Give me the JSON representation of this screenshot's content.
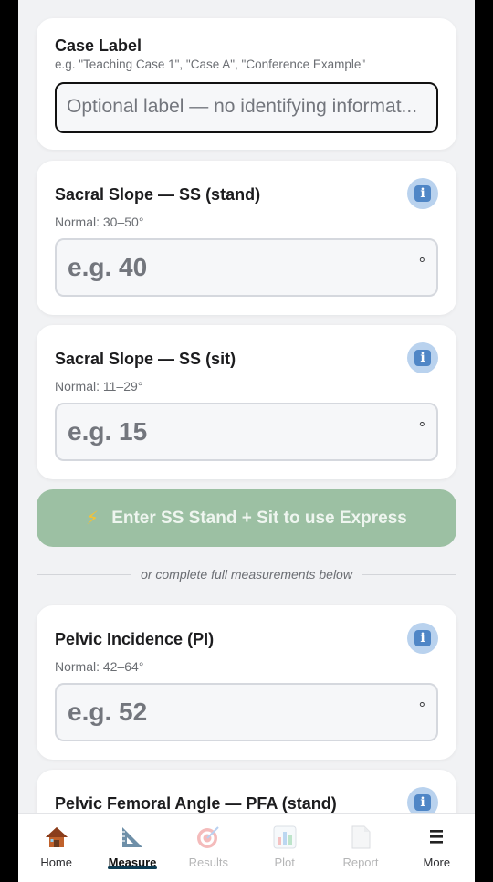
{
  "case_label": {
    "title": "Case Label",
    "hint": "e.g. \"Teaching Case 1\", \"Case A\", \"Conference Example\"",
    "placeholder": "Optional label — no identifying informat..."
  },
  "measurements": [
    {
      "title": "Sacral Slope — SS (stand)",
      "normal": "Normal: 30–50°",
      "placeholder": "e.g. 40",
      "unit": "°"
    },
    {
      "title": "Sacral Slope — SS (sit)",
      "normal": "Normal: 11–29°",
      "placeholder": "e.g. 15",
      "unit": "°"
    },
    {
      "title": "Pelvic Incidence (PI)",
      "normal": "Normal: 42–64°",
      "placeholder": "e.g. 52",
      "unit": "°"
    },
    {
      "title": "Pelvic Femoral Angle — PFA (stand)"
    }
  ],
  "express_button": {
    "icon": "lightning-icon",
    "label": "Enter SS Stand + Sit to use Express"
  },
  "divider_text": "or complete full measurements below",
  "tabs": [
    {
      "label": "Home",
      "icon": "house-icon",
      "state": "normal"
    },
    {
      "label": "Measure",
      "icon": "set-square-icon",
      "state": "active"
    },
    {
      "label": "Results",
      "icon": "target-icon",
      "state": "disabled"
    },
    {
      "label": "Plot",
      "icon": "bar-chart-icon",
      "state": "disabled"
    },
    {
      "label": "Report",
      "icon": "document-icon",
      "state": "disabled"
    },
    {
      "label": "More",
      "icon": "menu-icon",
      "state": "normal"
    }
  ],
  "colors": {
    "express_bg": "#9cc0a3",
    "active_underline": "#0c3b52",
    "info_btn": "#4f86c6"
  }
}
